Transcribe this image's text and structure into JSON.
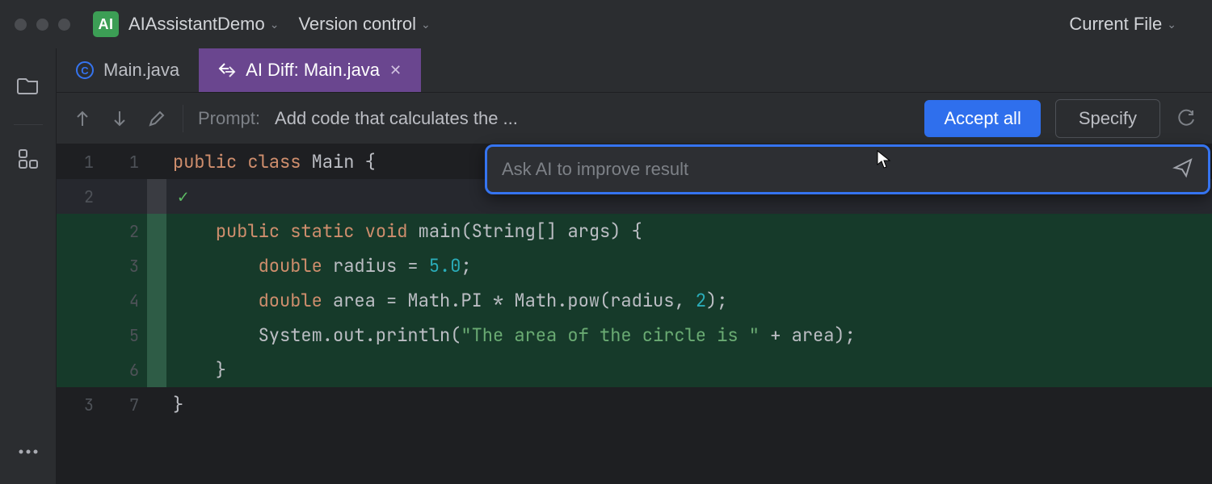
{
  "titlebar": {
    "app_icon_text": "AI",
    "project_name": "AIAssistantDemo",
    "version_control_label": "Version control",
    "current_file_label": "Current File"
  },
  "tabs": {
    "inactive": {
      "label": "Main.java",
      "icon_letter": "C"
    },
    "active": {
      "label": "AI Diff: Main.java"
    }
  },
  "promptbar": {
    "prompt_label": "Prompt:",
    "prompt_text": "Add code that calculates the ...",
    "accept_label": "Accept all",
    "specify_label": "Specify"
  },
  "ai_input": {
    "placeholder": "Ask AI to improve result"
  },
  "code": {
    "rows": [
      {
        "left": "1",
        "right": "1",
        "kind": "plain",
        "tokens": [
          {
            "cls": "tk-keyword",
            "t": "public "
          },
          {
            "cls": "tk-keyword",
            "t": "class "
          },
          {
            "cls": "tk-ident",
            "t": "Main "
          },
          {
            "cls": "tk-punc",
            "t": "{"
          }
        ]
      },
      {
        "left": "2",
        "right": "",
        "kind": "caret",
        "check": true,
        "tokens": []
      },
      {
        "left": "",
        "right": "2",
        "kind": "addition",
        "tokens": [
          {
            "cls": "tk-ident",
            "t": "    "
          },
          {
            "cls": "tk-keyword",
            "t": "public "
          },
          {
            "cls": "tk-keyword",
            "t": "static "
          },
          {
            "cls": "tk-keyword",
            "t": "void "
          },
          {
            "cls": "tk-ident",
            "t": "main"
          },
          {
            "cls": "tk-punc",
            "t": "(String[] args) {"
          }
        ]
      },
      {
        "left": "",
        "right": "3",
        "kind": "addition",
        "tokens": [
          {
            "cls": "tk-ident",
            "t": "        "
          },
          {
            "cls": "tk-keyword",
            "t": "double "
          },
          {
            "cls": "tk-ident",
            "t": "radius = "
          },
          {
            "cls": "tk-num",
            "t": "5.0"
          },
          {
            "cls": "tk-punc",
            "t": ";"
          }
        ]
      },
      {
        "left": "",
        "right": "4",
        "kind": "addition",
        "tokens": [
          {
            "cls": "tk-ident",
            "t": "        "
          },
          {
            "cls": "tk-keyword",
            "t": "double "
          },
          {
            "cls": "tk-ident",
            "t": "area = Math.PI * Math.pow(radius, "
          },
          {
            "cls": "tk-num",
            "t": "2"
          },
          {
            "cls": "tk-punc",
            "t": ");"
          }
        ]
      },
      {
        "left": "",
        "right": "5",
        "kind": "addition",
        "tokens": [
          {
            "cls": "tk-ident",
            "t": "        System.out.println("
          },
          {
            "cls": "tk-string",
            "t": "\"The area of the circle is \""
          },
          {
            "cls": "tk-ident",
            "t": " + area);"
          }
        ]
      },
      {
        "left": "",
        "right": "6",
        "kind": "addition",
        "tokens": [
          {
            "cls": "tk-ident",
            "t": "    }"
          }
        ]
      },
      {
        "left": "3",
        "right": "7",
        "kind": "plain",
        "tokens": [
          {
            "cls": "tk-ident",
            "t": "}"
          }
        ]
      }
    ]
  }
}
